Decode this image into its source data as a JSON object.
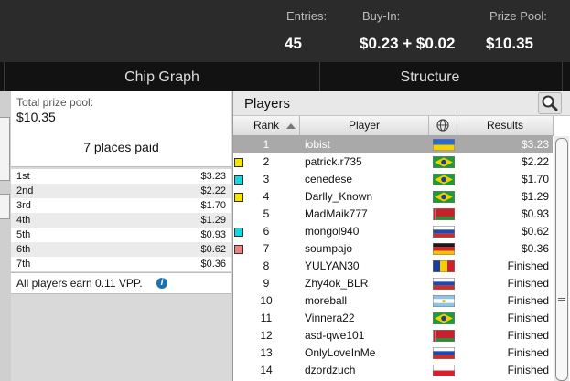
{
  "header": {
    "entries_label": "Entries:",
    "entries_value": "45",
    "buyin_label": "Buy-In:",
    "buyin_value": "$0.23 + $0.02",
    "prize_label": "Prize Pool:",
    "prize_value": "$10.35"
  },
  "tabs": [
    {
      "label": "Chip Graph"
    },
    {
      "label": "Structure"
    }
  ],
  "prize_panel": {
    "total_label": "Total prize pool:",
    "total_value": "$10.35",
    "places_paid": "7 places paid",
    "payouts": [
      {
        "place": "1st",
        "amount": "$3.23"
      },
      {
        "place": "2nd",
        "amount": "$2.22"
      },
      {
        "place": "3rd",
        "amount": "$1.70"
      },
      {
        "place": "4th",
        "amount": "$1.29"
      },
      {
        "place": "5th",
        "amount": "$0.93"
      },
      {
        "place": "6th",
        "amount": "$0.62"
      },
      {
        "place": "7th",
        "amount": "$0.36"
      }
    ],
    "vpp_text": "All players earn 0.11 VPP.",
    "info_icon": "i"
  },
  "players_panel": {
    "title": "Players",
    "search_icon": "magnifier-icon",
    "columns": {
      "rank": "Rank",
      "player": "Player",
      "country": "globe-icon",
      "results": "Results"
    },
    "sort": {
      "column": "Rank",
      "direction": "ascending"
    },
    "rows": [
      {
        "rank": "1",
        "player": "iobist",
        "flag": "ukraine",
        "result": "$3.23",
        "selected": true,
        "marker": ""
      },
      {
        "rank": "2",
        "player": "patrick.r735",
        "flag": "brazil",
        "result": "$2.22",
        "marker": "#f5e400"
      },
      {
        "rank": "3",
        "player": "cenedese",
        "flag": "brazil",
        "result": "$1.70",
        "marker": "#18d6e0"
      },
      {
        "rank": "4",
        "player": "Darlly_Known",
        "flag": "brazil",
        "result": "$1.29",
        "marker": "#f5e400"
      },
      {
        "rank": "5",
        "player": "MadMaik777",
        "flag": "belarus",
        "result": "$0.93",
        "marker": ""
      },
      {
        "rank": "6",
        "player": "mongol940",
        "flag": "russia",
        "result": "$0.62",
        "marker": "#18d6e0"
      },
      {
        "rank": "7",
        "player": "soumpajo",
        "flag": "germany",
        "result": "$0.36",
        "marker": "#f08080"
      },
      {
        "rank": "8",
        "player": "YULYAN30",
        "flag": "romania",
        "result": "Finished",
        "marker": ""
      },
      {
        "rank": "9",
        "player": "Zhy4ok_BLR",
        "flag": "russia",
        "result": "Finished",
        "marker": ""
      },
      {
        "rank": "10",
        "player": "moreball",
        "flag": "argentina",
        "result": "Finished",
        "marker": ""
      },
      {
        "rank": "11",
        "player": "Vinnera22",
        "flag": "brazil",
        "result": "Finished",
        "marker": ""
      },
      {
        "rank": "12",
        "player": "asd-qwe101",
        "flag": "belarus",
        "result": "Finished",
        "marker": ""
      },
      {
        "rank": "13",
        "player": "OnlyLoveInMe",
        "flag": "russia",
        "result": "Finished",
        "marker": ""
      },
      {
        "rank": "14",
        "player": "dzordzuch",
        "flag": "poland",
        "result": "Finished",
        "marker": ""
      }
    ]
  },
  "colors": {
    "selected_row": "#a9a9a9",
    "header_bg": "#2b2b2b",
    "tab_bg": "#121212"
  }
}
